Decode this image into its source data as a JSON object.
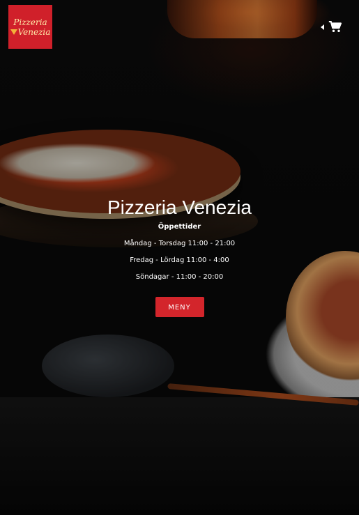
{
  "logo": {
    "line1": "Pizzeria",
    "line2": "Venezia"
  },
  "header": {
    "cart_icon": "cart-icon",
    "caret_icon": "caret-left-icon"
  },
  "hero": {
    "title": "Pizzeria Venezia",
    "hours_heading": "Öppettider",
    "hours": [
      "Måndag - Torsdag 11:00 - 21:00",
      "Fredag - Lördag 11:00 - 4:00",
      "Söndagar - 11:00 - 20:00"
    ],
    "menu_label": "MENY"
  },
  "colors": {
    "accent": "#d3252b",
    "logo_bg": "#d0202a",
    "logo_text": "#ffe9a8"
  }
}
